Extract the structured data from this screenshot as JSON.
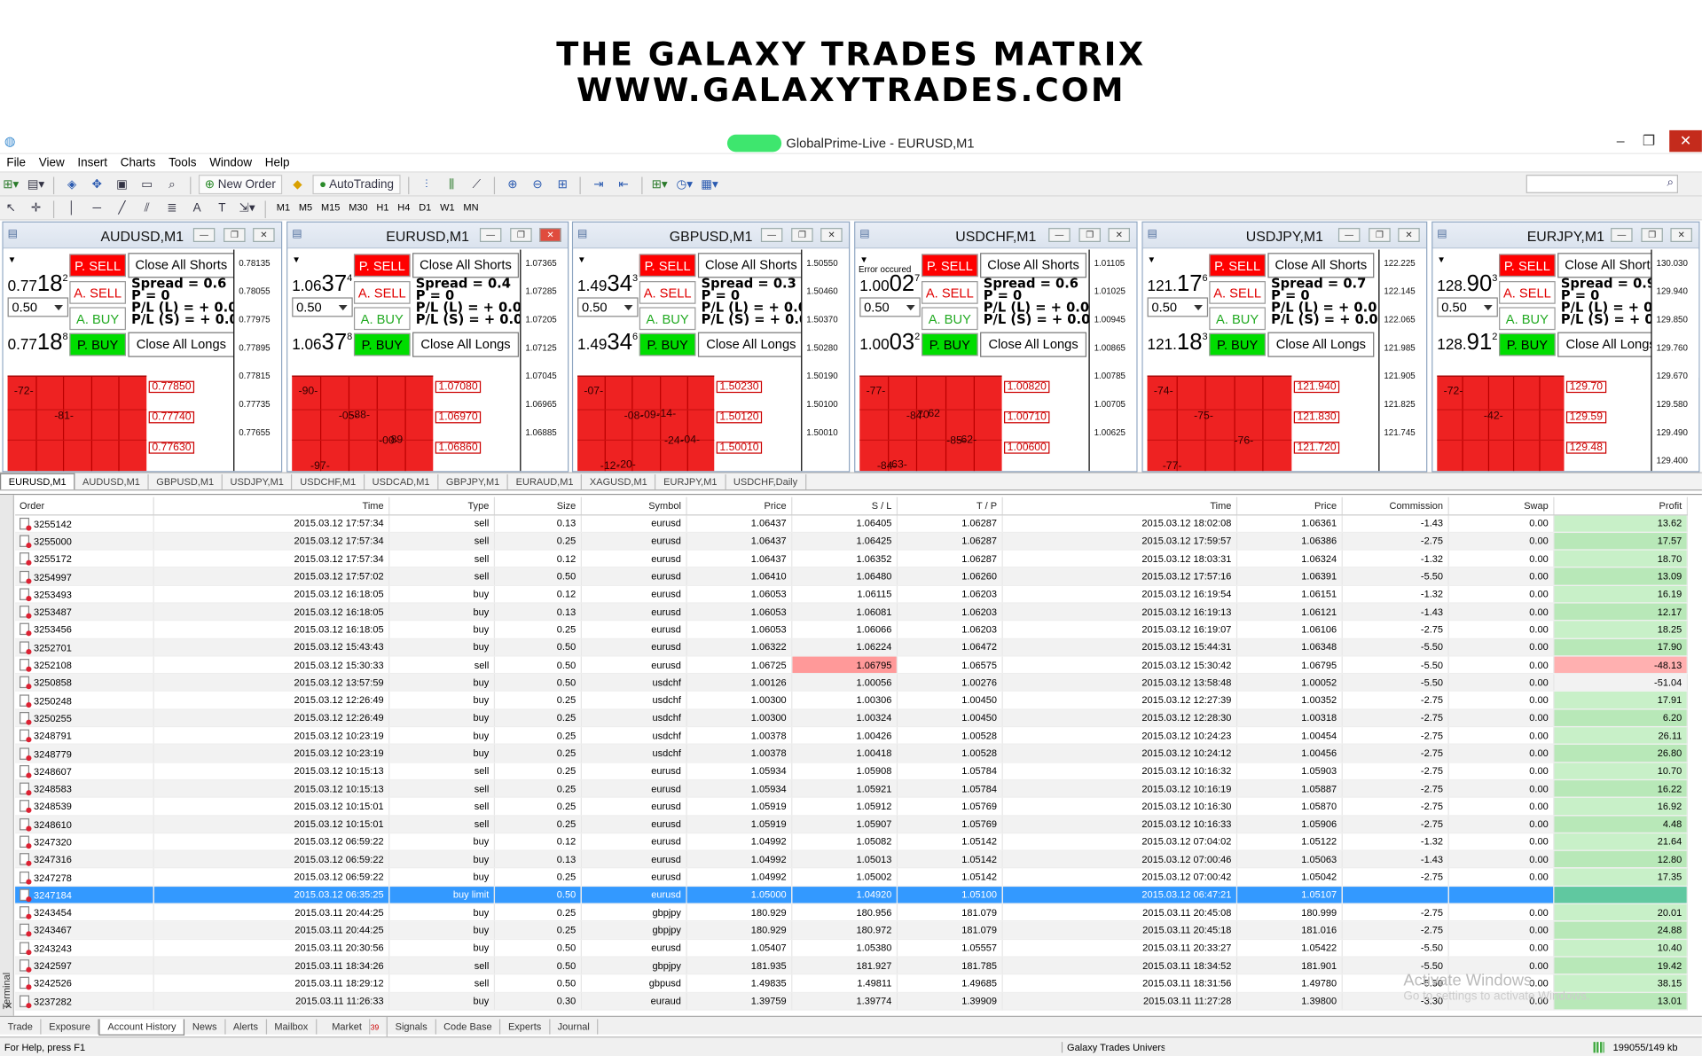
{
  "banner": {
    "line1": "THE GALAXY TRADES MATRIX",
    "line2": "WWW.GALAXYTRADES.COM"
  },
  "window": {
    "title": "GlobalPrime-Live - EURUSD,M1",
    "minimize": "–",
    "restore": "❐",
    "close": "✕"
  },
  "menu": [
    "File",
    "View",
    "Insert",
    "Charts",
    "Tools",
    "Window",
    "Help"
  ],
  "toolbar": {
    "new_order": "New Order",
    "autotrading": "AutoTrading",
    "timeframes": [
      "M1",
      "M5",
      "M15",
      "M30",
      "H1",
      "H4",
      "D1",
      "W1",
      "MN"
    ],
    "search_placeholder": ""
  },
  "trade_panel": {
    "p_sell": "P. SELL",
    "a_sell": "A. SELL",
    "a_buy": "A. BUY",
    "p_buy": "P. BUY",
    "close_shorts": "Close All Shorts",
    "close_longs": "Close All Longs",
    "p_label": "P  =  0",
    "pl_long": "P/L (L)  =  + 0.0",
    "pl_short": "P/L (S)  =  + 0.0",
    "lot": "0.50"
  },
  "charts": [
    {
      "symbol": "AUDUSD,M1",
      "bid_pre": "0.77",
      "bid_big": "18",
      "bid_sup": "2",
      "ask_pre": "0.77",
      "ask_big": "18",
      "ask_sup": "8",
      "spread": "Spread = 0.6",
      "note": "",
      "axis": [
        "0.78135",
        "0.78055",
        "0.77975",
        "0.77895",
        "0.77815",
        "0.77735",
        "0.77655"
      ],
      "bar_labels": [
        "-72-",
        "-81-"
      ],
      "levels": [
        "0.77850",
        "0.77740",
        "0.77630"
      ]
    },
    {
      "symbol": "EURUSD,M1",
      "bid_pre": "1.06",
      "bid_big": "37",
      "bid_sup": "4",
      "ask_pre": "1.06",
      "ask_big": "37",
      "ask_sup": "8",
      "spread": "Spread = 0.4",
      "note": "",
      "axis": [
        "1.07365",
        "1.07285",
        "1.07205",
        "1.07125",
        "1.07045",
        "1.06965",
        "1.06885"
      ],
      "bar_labels": [
        "-90-",
        "-05-",
        "-00-",
        "-97-",
        "-88-",
        "89"
      ],
      "levels": [
        "1.07080",
        "1.06970",
        "1.06860"
      ]
    },
    {
      "symbol": "GBPUSD,M1",
      "bid_pre": "1.49",
      "bid_big": "34",
      "bid_sup": "3",
      "ask_pre": "1.49",
      "ask_big": "34",
      "ask_sup": "6",
      "spread": "Spread = 0.3",
      "note": "",
      "axis": [
        "1.50550",
        "1.50460",
        "1.50370",
        "1.50280",
        "1.50190",
        "1.50100",
        "1.50010"
      ],
      "bar_labels": [
        "-07-",
        "-08-",
        "-24-",
        "-12-",
        "-09-",
        "-04-",
        "-20-",
        "-14-"
      ],
      "levels": [
        "1.50230",
        "1.50120",
        "1.50010"
      ]
    },
    {
      "symbol": "USDCHF,M1",
      "bid_pre": "1.00",
      "bid_big": "02",
      "bid_sup": "7",
      "ask_pre": "1.00",
      "ask_big": "03",
      "ask_sup": "2",
      "spread": "Spread = 0.6",
      "note": "Error occured",
      "axis": [
        "1.01105",
        "1.01025",
        "1.00945",
        "1.00865",
        "1.00785",
        "1.00705",
        "1.00625"
      ],
      "bar_labels": [
        "-77-",
        "-84-",
        "-85-",
        "-84-",
        "70",
        "-62-",
        "-63-",
        "62"
      ],
      "levels": [
        "1.00820",
        "1.00710",
        "1.00600"
      ]
    },
    {
      "symbol": "USDJPY,M1",
      "bid_pre": "121.",
      "bid_big": "17",
      "bid_sup": "6",
      "ask_pre": "121.",
      "ask_big": "18",
      "ask_sup": "3",
      "spread": "Spread = 0.7",
      "note": "",
      "axis": [
        "122.225",
        "122.145",
        "122.065",
        "121.985",
        "121.905",
        "121.825",
        "121.745"
      ],
      "bar_labels": [
        "-74-",
        "-75-",
        "-76-",
        "-77-"
      ],
      "levels": [
        "121.940",
        "121.830",
        "121.720"
      ]
    },
    {
      "symbol": "EURJPY,M1",
      "bid_pre": "128.",
      "bid_big": "90",
      "bid_sup": "3",
      "ask_pre": "128.",
      "ask_big": "91",
      "ask_sup": "2",
      "spread": "Spread = 0.9",
      "note": "",
      "axis": [
        "130.030",
        "129.940",
        "129.850",
        "129.760",
        "129.670",
        "129.580",
        "129.490",
        "129.400"
      ],
      "bar_labels": [
        "-72-",
        "-42-"
      ],
      "levels": [
        "129.70",
        "129.59",
        "129.48"
      ]
    }
  ],
  "chart_tabs": [
    "EURUSD,M1",
    "AUDUSD,M1",
    "GBPUSD,M1",
    "USDJPY,M1",
    "USDCHF,M1",
    "USDCAD,M1",
    "GBPJPY,M1",
    "EURAUD,M1",
    "XAGUSD,M1",
    "EURJPY,M1",
    "USDCHF,Daily"
  ],
  "history": {
    "columns": [
      "Order",
      "Time",
      "Type",
      "Size",
      "Symbol",
      "Price",
      "S / L",
      "T / P",
      "Time",
      "Price",
      "Commission",
      "Swap",
      "Profit"
    ],
    "rows": [
      [
        "3255142",
        "2015.03.12 17:57:34",
        "sell",
        "0.13",
        "eurusd",
        "1.06437",
        "1.06405",
        "1.06287",
        "2015.03.12 18:02:08",
        "1.06361",
        "-1.43",
        "0.00",
        "13.62"
      ],
      [
        "3255000",
        "2015.03.12 17:57:34",
        "sell",
        "0.25",
        "eurusd",
        "1.06437",
        "1.06425",
        "1.06287",
        "2015.03.12 17:59:57",
        "1.06386",
        "-2.75",
        "0.00",
        "17.57"
      ],
      [
        "3255172",
        "2015.03.12 17:57:34",
        "sell",
        "0.12",
        "eurusd",
        "1.06437",
        "1.06352",
        "1.06287",
        "2015.03.12 18:03:31",
        "1.06324",
        "-1.32",
        "0.00",
        "18.70"
      ],
      [
        "3254997",
        "2015.03.12 17:57:02",
        "sell",
        "0.50",
        "eurusd",
        "1.06410",
        "1.06480",
        "1.06260",
        "2015.03.12 17:57:16",
        "1.06391",
        "-5.50",
        "0.00",
        "13.09"
      ],
      [
        "3253493",
        "2015.03.12 16:18:05",
        "buy",
        "0.12",
        "eurusd",
        "1.06053",
        "1.06115",
        "1.06203",
        "2015.03.12 16:19:54",
        "1.06151",
        "-1.32",
        "0.00",
        "16.19"
      ],
      [
        "3253487",
        "2015.03.12 16:18:05",
        "buy",
        "0.13",
        "eurusd",
        "1.06053",
        "1.06081",
        "1.06203",
        "2015.03.12 16:19:13",
        "1.06121",
        "-1.43",
        "0.00",
        "12.17"
      ],
      [
        "3253456",
        "2015.03.12 16:18:05",
        "buy",
        "0.25",
        "eurusd",
        "1.06053",
        "1.06066",
        "1.06203",
        "2015.03.12 16:19:07",
        "1.06106",
        "-2.75",
        "0.00",
        "18.25"
      ],
      [
        "3252701",
        "2015.03.12 15:43:43",
        "buy",
        "0.50",
        "eurusd",
        "1.06322",
        "1.06224",
        "1.06472",
        "2015.03.12 15:44:31",
        "1.06348",
        "-5.50",
        "0.00",
        "17.90"
      ],
      [
        "3252108",
        "2015.03.12 15:30:33",
        "sell",
        "0.50",
        "eurusd",
        "1.06725",
        "1.06795",
        "1.06575",
        "2015.03.12 15:30:42",
        "1.06795",
        "-5.50",
        "0.00",
        "-48.13"
      ],
      [
        "3250858",
        "2015.03.12 13:57:59",
        "buy",
        "0.50",
        "usdchf",
        "1.00126",
        "1.00056",
        "1.00276",
        "2015.03.12 13:58:48",
        "1.00052",
        "-5.50",
        "0.00",
        "-51.04"
      ],
      [
        "3250248",
        "2015.03.12 12:26:49",
        "buy",
        "0.25",
        "usdchf",
        "1.00300",
        "1.00306",
        "1.00450",
        "2015.03.12 12:27:39",
        "1.00352",
        "-2.75",
        "0.00",
        "17.91"
      ],
      [
        "3250255",
        "2015.03.12 12:26:49",
        "buy",
        "0.25",
        "usdchf",
        "1.00300",
        "1.00324",
        "1.00450",
        "2015.03.12 12:28:30",
        "1.00318",
        "-2.75",
        "0.00",
        "6.20"
      ],
      [
        "3248791",
        "2015.03.12 10:23:19",
        "buy",
        "0.25",
        "usdchf",
        "1.00378",
        "1.00426",
        "1.00528",
        "2015.03.12 10:24:23",
        "1.00454",
        "-2.75",
        "0.00",
        "26.11"
      ],
      [
        "3248779",
        "2015.03.12 10:23:19",
        "buy",
        "0.25",
        "usdchf",
        "1.00378",
        "1.00418",
        "1.00528",
        "2015.03.12 10:24:12",
        "1.00456",
        "-2.75",
        "0.00",
        "26.80"
      ],
      [
        "3248607",
        "2015.03.12 10:15:13",
        "sell",
        "0.25",
        "eurusd",
        "1.05934",
        "1.05908",
        "1.05784",
        "2015.03.12 10:16:32",
        "1.05903",
        "-2.75",
        "0.00",
        "10.70"
      ],
      [
        "3248583",
        "2015.03.12 10:15:13",
        "sell",
        "0.25",
        "eurusd",
        "1.05934",
        "1.05921",
        "1.05784",
        "2015.03.12 10:16:19",
        "1.05887",
        "-2.75",
        "0.00",
        "16.22"
      ],
      [
        "3248539",
        "2015.03.12 10:15:01",
        "sell",
        "0.25",
        "eurusd",
        "1.05919",
        "1.05912",
        "1.05769",
        "2015.03.12 10:16:30",
        "1.05870",
        "-2.75",
        "0.00",
        "16.92"
      ],
      [
        "3248610",
        "2015.03.12 10:15:01",
        "sell",
        "0.25",
        "eurusd",
        "1.05919",
        "1.05907",
        "1.05769",
        "2015.03.12 10:16:33",
        "1.05906",
        "-2.75",
        "0.00",
        "4.48"
      ],
      [
        "3247320",
        "2015.03.12 06:59:22",
        "buy",
        "0.12",
        "eurusd",
        "1.04992",
        "1.05082",
        "1.05142",
        "2015.03.12 07:04:02",
        "1.05122",
        "-1.32",
        "0.00",
        "21.64"
      ],
      [
        "3247316",
        "2015.03.12 06:59:22",
        "buy",
        "0.13",
        "eurusd",
        "1.04992",
        "1.05013",
        "1.05142",
        "2015.03.12 07:00:46",
        "1.05063",
        "-1.43",
        "0.00",
        "12.80"
      ],
      [
        "3247278",
        "2015.03.12 06:59:22",
        "buy",
        "0.25",
        "eurusd",
        "1.04992",
        "1.05002",
        "1.05142",
        "2015.03.12 07:00:42",
        "1.05042",
        "-2.75",
        "0.00",
        "17.35"
      ],
      [
        "3247184",
        "2015.03.12 06:35:25",
        "buy limit",
        "0.50",
        "eurusd",
        "1.05000",
        "1.04920",
        "1.05100",
        "2015.03.12 06:47:21",
        "1.05107",
        "",
        "",
        ""
      ],
      [
        "3243454",
        "2015.03.11 20:44:25",
        "buy",
        "0.25",
        "gbpjpy",
        "180.929",
        "180.956",
        "181.079",
        "2015.03.11 20:45:08",
        "180.999",
        "-2.75",
        "0.00",
        "20.01"
      ],
      [
        "3243467",
        "2015.03.11 20:44:25",
        "buy",
        "0.25",
        "gbpjpy",
        "180.929",
        "180.972",
        "181.079",
        "2015.03.11 20:45:18",
        "181.016",
        "-2.75",
        "0.00",
        "24.88"
      ],
      [
        "3243243",
        "2015.03.11 20:30:56",
        "buy",
        "0.50",
        "eurusd",
        "1.05407",
        "1.05380",
        "1.05557",
        "2015.03.11 20:33:27",
        "1.05422",
        "-5.50",
        "0.00",
        "10.40"
      ],
      [
        "3242597",
        "2015.03.11 18:34:26",
        "sell",
        "0.50",
        "gbpjpy",
        "181.935",
        "181.927",
        "181.785",
        "2015.03.11 18:34:52",
        "181.901",
        "-5.50",
        "0.00",
        "19.42"
      ],
      [
        "3242526",
        "2015.03.11 18:29:12",
        "sell",
        "0.50",
        "gbpusd",
        "1.49835",
        "1.49811",
        "1.49685",
        "2015.03.11 18:31:56",
        "1.49780",
        "-5.50",
        "0.00",
        "38.15"
      ],
      [
        "3237282",
        "2015.03.11 11:26:33",
        "buy",
        "0.30",
        "euraud",
        "1.39759",
        "1.39774",
        "1.39909",
        "2015.03.11 11:27:28",
        "1.39800",
        "-3.30",
        "0.00",
        "13.01"
      ]
    ]
  },
  "bottom_tabs": [
    "Trade",
    "Exposure",
    "Account History",
    "News",
    "Alerts",
    "Mailbox",
    "Market",
    "Signals",
    "Code Base",
    "Experts",
    "Journal"
  ],
  "market_badge": "39",
  "terminal_label": "Terminal",
  "status": {
    "help": "For Help, press F1",
    "profile": "Galaxy Trades Univers",
    "traffic": "199055/149 kb"
  },
  "watermark": {
    "line1": "Activate Windows",
    "line2": "Go to settings to activate Windows."
  }
}
